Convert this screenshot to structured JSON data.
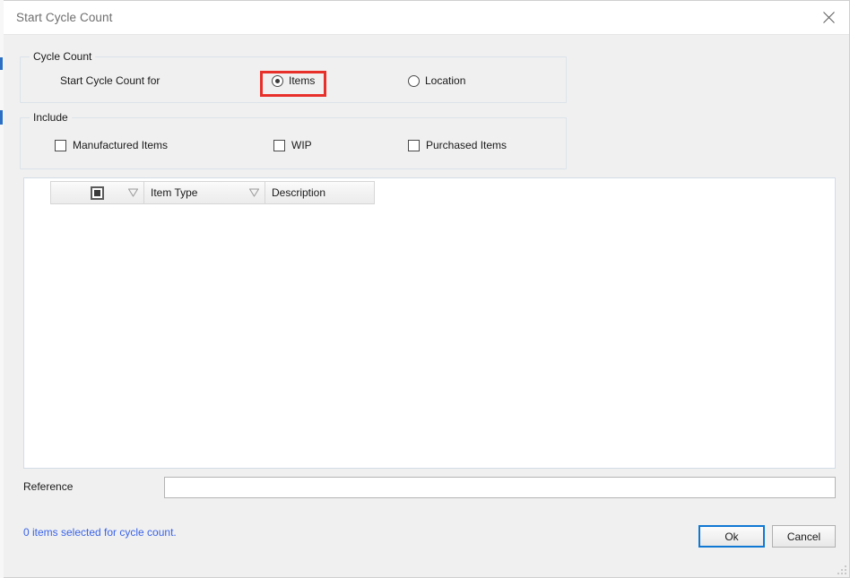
{
  "window": {
    "title": "Start Cycle Count",
    "close_icon": "close-icon",
    "resize_grip_icon": "resize-grip-icon"
  },
  "cycle_count_group": {
    "legend": "Cycle Count",
    "field_label": "Start Cycle Count for",
    "options": [
      {
        "label": "Items",
        "selected": true,
        "highlighted": true
      },
      {
        "label": "Location",
        "selected": false,
        "highlighted": false
      }
    ],
    "highlight_color": "#e8302a"
  },
  "include_group": {
    "legend": "Include",
    "checkboxes": [
      {
        "label": "Manufactured Items",
        "checked": false
      },
      {
        "label": "WIP",
        "checked": false
      },
      {
        "label": "Purchased Items",
        "checked": false
      }
    ]
  },
  "grid": {
    "columns": [
      {
        "label": "",
        "icon": "select-all-checkbox-icon",
        "filter": true
      },
      {
        "label": "Item Type",
        "filter": true
      },
      {
        "label": "Description",
        "filter": false
      }
    ],
    "rows": []
  },
  "reference": {
    "label": "Reference",
    "value": "",
    "placeholder": ""
  },
  "status": {
    "text": "0 items selected for cycle count.",
    "color": "#3a63e8"
  },
  "footer": {
    "ok_label": "Ok",
    "cancel_label": "Cancel",
    "focus_color": "#0f78d4"
  }
}
